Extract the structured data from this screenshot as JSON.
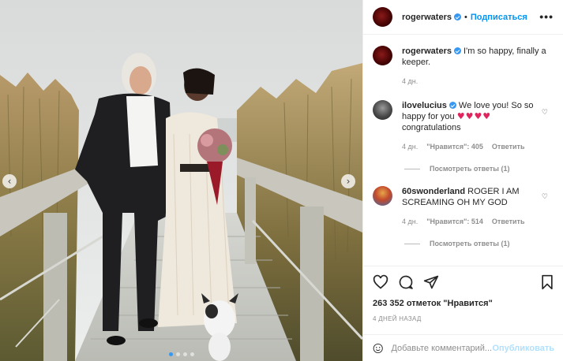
{
  "post": {
    "author": "rogerwaters",
    "follow_label": "Подписаться",
    "separator": "•",
    "more_label": "•••"
  },
  "caption": {
    "author": "rogerwaters",
    "text": "I'm so happy, finally a keeper.",
    "time": "4 дн."
  },
  "comments": [
    {
      "author": "ilovelucius",
      "text_before": "We love you! So so happy for you",
      "hearts": "♥♥♥♥",
      "text_after": "congratulations",
      "time": "4 дн.",
      "likes": "\"Нравится\": 405",
      "reply_label": "Ответить",
      "view_replies": "Посмотреть ответы (1)"
    },
    {
      "author": "60swonderland",
      "text": "ROGER I AM SCREAMING OH MY GOD",
      "time": "4 дн.",
      "likes": "\"Нравится\": 514",
      "reply_label": "Ответить",
      "view_replies": "Посмотреть ответы (1)"
    }
  ],
  "stats": {
    "likes": "263 352 отметок \"Нравится\"",
    "date": "4 ДНЕЙ НАЗАД"
  },
  "composer": {
    "placeholder": "Добавьте комментарий...",
    "publish_label": "Опубликовать"
  },
  "carousel": {
    "prev_icon": "chevron-left-icon",
    "next_icon": "chevron-right-icon",
    "slide_count": 4,
    "active_index": 0
  },
  "colors": {
    "accent": "#0095f6",
    "verified": "#3897f0",
    "muted": "#8e8e8e",
    "heart": "#e0245e"
  }
}
